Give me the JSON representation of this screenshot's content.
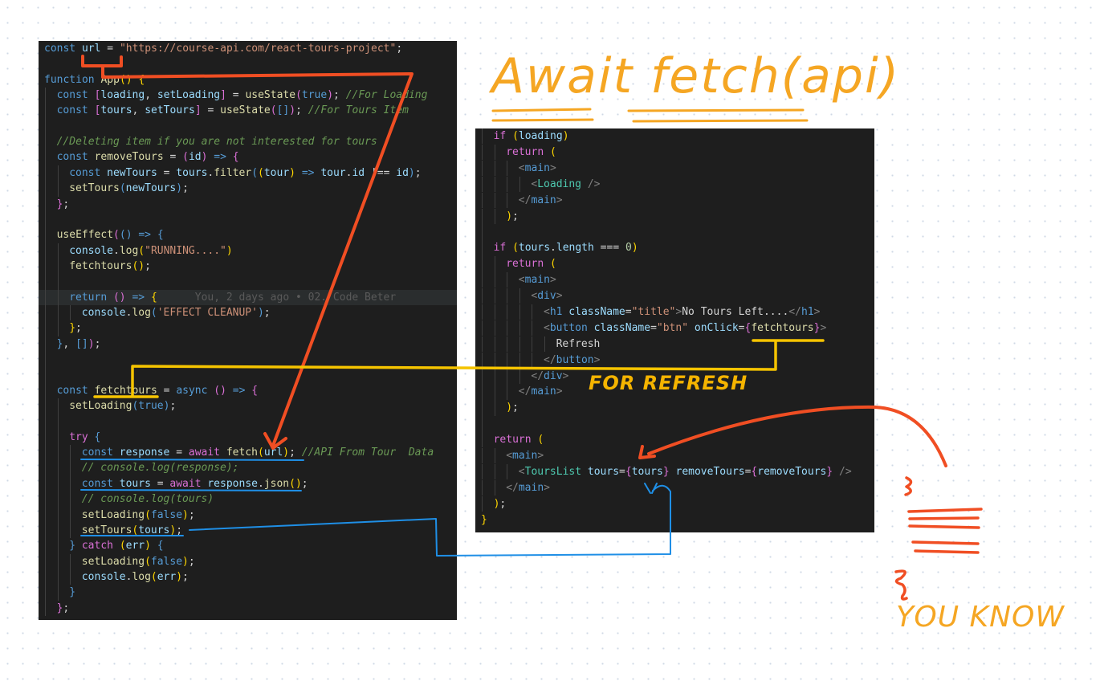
{
  "annotations": {
    "title": "Await fetch(api)",
    "for_refresh": "FOR REFRESH",
    "you_know": "YOU KNOW",
    "colors": {
      "red": "#f04e23",
      "yellow": "#f5c400",
      "blue": "#1f8fe6",
      "orange": "#f5a623"
    }
  },
  "blame_text": "You, 2 days ago • 02. Code Beter",
  "left_code": [
    {
      "i": 0,
      "t": [
        [
          "k",
          "const "
        ],
        [
          "v",
          "url"
        ],
        [
          "p",
          " = "
        ],
        [
          "s",
          "\"https://course-api.com/react-tours-project\""
        ],
        [
          "p",
          ";"
        ]
      ]
    },
    {
      "i": 0,
      "t": []
    },
    {
      "i": 0,
      "t": [
        [
          "k",
          "function "
        ],
        [
          "f",
          "App"
        ],
        [
          "gl",
          "() {"
        ]
      ]
    },
    {
      "i": 1,
      "t": [
        [
          "k",
          "const "
        ],
        [
          "pk",
          "["
        ],
        [
          "v",
          "loading"
        ],
        [
          "p",
          ", "
        ],
        [
          "v",
          "setLoading"
        ],
        [
          "pk",
          "]"
        ],
        [
          "p",
          " = "
        ],
        [
          "f",
          "useState"
        ],
        [
          "pk",
          "("
        ],
        [
          "k",
          "true"
        ],
        [
          "pk",
          ")"
        ],
        [
          "p",
          "; "
        ],
        [
          "c",
          "//For Loading"
        ]
      ]
    },
    {
      "i": 1,
      "t": [
        [
          "k",
          "const "
        ],
        [
          "pk",
          "["
        ],
        [
          "v",
          "tours"
        ],
        [
          "p",
          ", "
        ],
        [
          "v",
          "setTours"
        ],
        [
          "pk",
          "]"
        ],
        [
          "p",
          " = "
        ],
        [
          "f",
          "useState"
        ],
        [
          "pk",
          "("
        ],
        [
          "bl",
          "[]"
        ],
        [
          "pk",
          ")"
        ],
        [
          "p",
          "; "
        ],
        [
          "c",
          "//For Tours Item"
        ]
      ]
    },
    {
      "i": 1,
      "t": []
    },
    {
      "i": 1,
      "t": [
        [
          "c",
          "//Deleting item if you are not interested for tours"
        ]
      ]
    },
    {
      "i": 1,
      "t": [
        [
          "k",
          "const "
        ],
        [
          "f",
          "removeTours"
        ],
        [
          "p",
          " = "
        ],
        [
          "pk",
          "("
        ],
        [
          "v",
          "id"
        ],
        [
          "pk",
          ")"
        ],
        [
          "k",
          " => "
        ],
        [
          "pk",
          "{"
        ]
      ]
    },
    {
      "i": 2,
      "t": [
        [
          "k",
          "const "
        ],
        [
          "v",
          "newTours"
        ],
        [
          "p",
          " = "
        ],
        [
          "v",
          "tours"
        ],
        [
          "p",
          "."
        ],
        [
          "f",
          "filter"
        ],
        [
          "bl",
          "("
        ],
        [
          "gl",
          "("
        ],
        [
          "v",
          "tour"
        ],
        [
          "gl",
          ")"
        ],
        [
          "k",
          " => "
        ],
        [
          "v",
          "tour"
        ],
        [
          "p",
          "."
        ],
        [
          "v",
          "id"
        ],
        [
          "p",
          " !== "
        ],
        [
          "v",
          "id"
        ],
        [
          "bl",
          ")"
        ],
        [
          "p",
          ";"
        ]
      ]
    },
    {
      "i": 2,
      "t": [
        [
          "f",
          "setTours"
        ],
        [
          "bl",
          "("
        ],
        [
          "v",
          "newTours"
        ],
        [
          "bl",
          ")"
        ],
        [
          "p",
          ";"
        ]
      ]
    },
    {
      "i": 1,
      "t": [
        [
          "pk",
          "}"
        ],
        [
          "p",
          ";"
        ]
      ]
    },
    {
      "i": 1,
      "t": []
    },
    {
      "i": 1,
      "t": [
        [
          "f",
          "useEffect"
        ],
        [
          "pk",
          "("
        ],
        [
          "bl",
          "()"
        ],
        [
          "k",
          " => "
        ],
        [
          "bl",
          "{"
        ]
      ]
    },
    {
      "i": 2,
      "t": [
        [
          "v",
          "console"
        ],
        [
          "p",
          "."
        ],
        [
          "f",
          "log"
        ],
        [
          "gl",
          "("
        ],
        [
          "s",
          "\"RUNNING....\""
        ],
        [
          "gl",
          ")"
        ]
      ]
    },
    {
      "i": 2,
      "t": [
        [
          "f",
          "fetchtours"
        ],
        [
          "gl",
          "()"
        ],
        [
          "p",
          ";"
        ]
      ]
    },
    {
      "i": 2,
      "t": []
    },
    {
      "i": 2,
      "hl": true,
      "blame": true,
      "t": [
        [
          "k",
          "return "
        ],
        [
          "pk",
          "()"
        ],
        [
          "k",
          " => "
        ],
        [
          "gl",
          "{"
        ]
      ]
    },
    {
      "i": 3,
      "t": [
        [
          "v",
          "console"
        ],
        [
          "p",
          "."
        ],
        [
          "f",
          "log"
        ],
        [
          "bl",
          "("
        ],
        [
          "s",
          "'EFFECT CLEANUP'"
        ],
        [
          "bl",
          ")"
        ],
        [
          "p",
          ";"
        ]
      ]
    },
    {
      "i": 2,
      "t": [
        [
          "gl",
          "}"
        ],
        [
          "p",
          ";"
        ]
      ]
    },
    {
      "i": 1,
      "t": [
        [
          "bl",
          "}"
        ],
        [
          "p",
          ", "
        ],
        [
          "bl",
          "[]"
        ],
        [
          "pk",
          ")"
        ],
        [
          "p",
          ";"
        ]
      ]
    },
    {
      "i": 1,
      "t": []
    },
    {
      "i": 1,
      "t": []
    },
    {
      "i": 1,
      "t": [
        [
          "k",
          "const "
        ],
        [
          "f",
          "fetchtours"
        ],
        [
          "p",
          " = "
        ],
        [
          "k",
          "async "
        ],
        [
          "pk",
          "()"
        ],
        [
          "k",
          " => "
        ],
        [
          "pk",
          "{"
        ]
      ]
    },
    {
      "i": 2,
      "t": [
        [
          "f",
          "setLoading"
        ],
        [
          "bl",
          "("
        ],
        [
          "k",
          "true"
        ],
        [
          "bl",
          ")"
        ],
        [
          "p",
          ";"
        ]
      ]
    },
    {
      "i": 2,
      "t": []
    },
    {
      "i": 2,
      "t": [
        [
          "pk",
          "try "
        ],
        [
          "bl",
          "{"
        ]
      ]
    },
    {
      "i": 3,
      "t": [
        [
          "k",
          "const "
        ],
        [
          "v",
          "response"
        ],
        [
          "p",
          " = "
        ],
        [
          "pk",
          "await "
        ],
        [
          "f",
          "fetch"
        ],
        [
          "gl",
          "("
        ],
        [
          "v",
          "url"
        ],
        [
          "gl",
          ")"
        ],
        [
          "p",
          "; "
        ],
        [
          "c",
          "//API From Tour  Data"
        ]
      ]
    },
    {
      "i": 3,
      "t": [
        [
          "c",
          "// console.log(response);"
        ]
      ]
    },
    {
      "i": 3,
      "t": [
        [
          "k",
          "const "
        ],
        [
          "v",
          "tours"
        ],
        [
          "p",
          " = "
        ],
        [
          "pk",
          "await "
        ],
        [
          "v",
          "response"
        ],
        [
          "p",
          "."
        ],
        [
          "f",
          "json"
        ],
        [
          "gl",
          "()"
        ],
        [
          "p",
          ";"
        ]
      ]
    },
    {
      "i": 3,
      "t": [
        [
          "c",
          "// console.log(tours)"
        ]
      ]
    },
    {
      "i": 3,
      "t": [
        [
          "f",
          "setLoading"
        ],
        [
          "gl",
          "("
        ],
        [
          "k",
          "false"
        ],
        [
          "gl",
          ")"
        ],
        [
          "p",
          ";"
        ]
      ]
    },
    {
      "i": 3,
      "t": [
        [
          "f",
          "setTours"
        ],
        [
          "gl",
          "("
        ],
        [
          "v",
          "tours"
        ],
        [
          "gl",
          ")"
        ],
        [
          "p",
          ";"
        ]
      ]
    },
    {
      "i": 2,
      "t": [
        [
          "bl",
          "} "
        ],
        [
          "pk",
          "catch "
        ],
        [
          "gl",
          "("
        ],
        [
          "v",
          "err"
        ],
        [
          "gl",
          ") "
        ],
        [
          "bl",
          "{"
        ]
      ]
    },
    {
      "i": 3,
      "t": [
        [
          "f",
          "setLoading"
        ],
        [
          "gl",
          "("
        ],
        [
          "k",
          "false"
        ],
        [
          "gl",
          ")"
        ],
        [
          "p",
          ";"
        ]
      ]
    },
    {
      "i": 3,
      "t": [
        [
          "v",
          "console"
        ],
        [
          "p",
          "."
        ],
        [
          "f",
          "log"
        ],
        [
          "gl",
          "("
        ],
        [
          "v",
          "err"
        ],
        [
          "gl",
          ")"
        ],
        [
          "p",
          ";"
        ]
      ]
    },
    {
      "i": 2,
      "t": [
        [
          "bl",
          "}"
        ]
      ]
    },
    {
      "i": 1,
      "t": [
        [
          "pk",
          "}"
        ],
        [
          "p",
          ";"
        ]
      ]
    }
  ],
  "right_code": [
    {
      "i": 1,
      "t": [
        [
          "pk",
          "if "
        ],
        [
          "gl",
          "("
        ],
        [
          "v",
          "loading"
        ],
        [
          "gl",
          ")"
        ]
      ]
    },
    {
      "i": 2,
      "t": [
        [
          "pk",
          "return "
        ],
        [
          "gl",
          "("
        ]
      ]
    },
    {
      "i": 3,
      "t": [
        [
          "t",
          "<"
        ],
        [
          "tg",
          "main"
        ],
        [
          "t",
          ">"
        ]
      ]
    },
    {
      "i": 4,
      "t": [
        [
          "t",
          "<"
        ],
        [
          "ct",
          "Loading"
        ],
        [
          "t",
          " />"
        ]
      ]
    },
    {
      "i": 3,
      "t": [
        [
          "t",
          "</"
        ],
        [
          "tg",
          "main"
        ],
        [
          "t",
          ">"
        ]
      ]
    },
    {
      "i": 2,
      "t": [
        [
          "gl",
          ")"
        ],
        [
          "p",
          ";"
        ]
      ]
    },
    {
      "i": 1,
      "t": []
    },
    {
      "i": 1,
      "t": [
        [
          "pk",
          "if "
        ],
        [
          "gl",
          "("
        ],
        [
          "v",
          "tours"
        ],
        [
          "p",
          "."
        ],
        [
          "v",
          "length"
        ],
        [
          "p",
          " === "
        ],
        [
          "n",
          "0"
        ],
        [
          "gl",
          ")"
        ]
      ]
    },
    {
      "i": 2,
      "t": [
        [
          "pk",
          "return "
        ],
        [
          "gl",
          "("
        ]
      ]
    },
    {
      "i": 3,
      "t": [
        [
          "t",
          "<"
        ],
        [
          "tg",
          "main"
        ],
        [
          "t",
          ">"
        ]
      ]
    },
    {
      "i": 4,
      "t": [
        [
          "t",
          "<"
        ],
        [
          "tg",
          "div"
        ],
        [
          "t",
          ">"
        ]
      ]
    },
    {
      "i": 5,
      "t": [
        [
          "t",
          "<"
        ],
        [
          "tg",
          "h1"
        ],
        [
          "at",
          " className"
        ],
        [
          "p",
          "="
        ],
        [
          "s",
          "\"title\""
        ],
        [
          "t",
          ">"
        ],
        [
          "p",
          "No Tours Left...."
        ],
        [
          "t",
          "</"
        ],
        [
          "tg",
          "h1"
        ],
        [
          "t",
          ">"
        ]
      ]
    },
    {
      "i": 5,
      "t": [
        [
          "t",
          "<"
        ],
        [
          "tg",
          "button"
        ],
        [
          "at",
          " className"
        ],
        [
          "p",
          "="
        ],
        [
          "s",
          "\"btn\""
        ],
        [
          "at",
          " onClick"
        ],
        [
          "p",
          "="
        ],
        [
          "pk",
          "{"
        ],
        [
          "f",
          "fetchtours"
        ],
        [
          "pk",
          "}"
        ],
        [
          "t",
          ">"
        ]
      ]
    },
    {
      "i": 6,
      "t": [
        [
          "p",
          "Refresh"
        ]
      ]
    },
    {
      "i": 5,
      "t": [
        [
          "t",
          "</"
        ],
        [
          "tg",
          "button"
        ],
        [
          "t",
          ">"
        ]
      ]
    },
    {
      "i": 4,
      "t": [
        [
          "t",
          "</"
        ],
        [
          "tg",
          "div"
        ],
        [
          "t",
          ">"
        ]
      ]
    },
    {
      "i": 3,
      "t": [
        [
          "t",
          "</"
        ],
        [
          "tg",
          "main"
        ],
        [
          "t",
          ">"
        ]
      ]
    },
    {
      "i": 2,
      "t": [
        [
          "gl",
          ")"
        ],
        [
          "p",
          ";"
        ]
      ]
    },
    {
      "i": 1,
      "t": []
    },
    {
      "i": 1,
      "t": [
        [
          "pk",
          "return "
        ],
        [
          "gl",
          "("
        ]
      ]
    },
    {
      "i": 2,
      "t": [
        [
          "t",
          "<"
        ],
        [
          "tg",
          "main"
        ],
        [
          "t",
          ">"
        ]
      ]
    },
    {
      "i": 3,
      "t": [
        [
          "t",
          "<"
        ],
        [
          "ct",
          "ToursList"
        ],
        [
          "at",
          " tours"
        ],
        [
          "p",
          "="
        ],
        [
          "pk",
          "{"
        ],
        [
          "v",
          "tours"
        ],
        [
          "pk",
          "}"
        ],
        [
          "at",
          " removeTours"
        ],
        [
          "p",
          "="
        ],
        [
          "pk",
          "{"
        ],
        [
          "v",
          "removeTours"
        ],
        [
          "pk",
          "}"
        ],
        [
          "t",
          " />"
        ]
      ]
    },
    {
      "i": 2,
      "t": [
        [
          "t",
          "</"
        ],
        [
          "tg",
          "main"
        ],
        [
          "t",
          ">"
        ]
      ]
    },
    {
      "i": 1,
      "t": [
        [
          "gl",
          ")"
        ],
        [
          "p",
          ";"
        ]
      ]
    },
    {
      "i": 0,
      "t": [
        [
          "gl",
          "}"
        ]
      ]
    }
  ]
}
